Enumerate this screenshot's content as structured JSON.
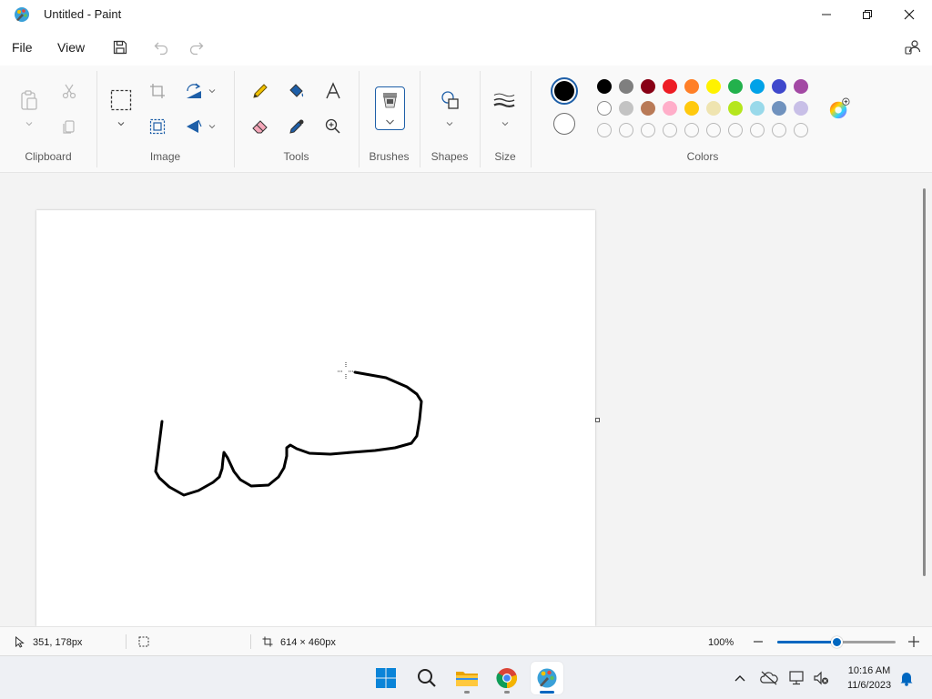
{
  "window": {
    "title": "Untitled - Paint"
  },
  "menu": {
    "file": "File",
    "view": "View"
  },
  "ribbon": {
    "groups": {
      "clipboard": "Clipboard",
      "image": "Image",
      "tools": "Tools",
      "brushes": "Brushes",
      "shapes": "Shapes",
      "size": "Size",
      "colors": "Colors"
    },
    "primary_color": "#000000",
    "secondary_color": "#ffffff",
    "palette_row1": [
      "#000000",
      "#7f7f7f",
      "#880015",
      "#ed1c24",
      "#ff7f27",
      "#fff200",
      "#22b14c",
      "#00a2e8",
      "#3f48cc",
      "#a349a4"
    ],
    "palette_row2": [
      "#ffffff",
      "#c3c3c3",
      "#b97a57",
      "#ffaec9",
      "#ffc90e",
      "#efe4b0",
      "#b5e61d",
      "#99d9ea",
      "#7092be",
      "#c8bfe7"
    ]
  },
  "status": {
    "cursor_position": "351, 178px",
    "canvas_size": "614 × 460px",
    "zoom": "100%",
    "zoom_fraction": 0.5
  },
  "taskbar": {
    "time": "10:16 AM",
    "date": "11/6/2023"
  },
  "accent_color": "#0067c0"
}
